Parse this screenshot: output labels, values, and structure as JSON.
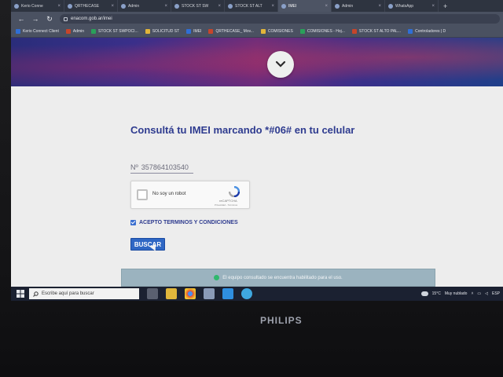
{
  "browser": {
    "tabs": [
      {
        "label": "Kerio Conne"
      },
      {
        "label": "QRTHECASE"
      },
      {
        "label": "Admin"
      },
      {
        "label": "STOCK ST SW"
      },
      {
        "label": "STOCK ST ALT"
      },
      {
        "label": "IMEI",
        "active": true
      },
      {
        "label": "Admin"
      },
      {
        "label": "WhatsApp"
      }
    ],
    "new_tab": "+",
    "url": "enacom.gob.ar/imei",
    "bookmarks": [
      {
        "label": "Kerio Connect Client"
      },
      {
        "label": "Admin"
      },
      {
        "label": "STOCK ST SWPOCI..."
      },
      {
        "label": "SOLICITUD ST"
      },
      {
        "label": "IMEI"
      },
      {
        "label": "QRTHECASE_ Mov..."
      },
      {
        "label": "COMISIONES"
      },
      {
        "label": "COMISIONES - Hoj..."
      },
      {
        "label": "STOCK ST ALTO PAL..."
      },
      {
        "label": "Controladores | D"
      }
    ]
  },
  "page": {
    "title": "Consultá tu IMEI marcando *#06# en tu celular",
    "imei_prefix": "Nº",
    "imei_value": "357864103540",
    "captcha": {
      "label": "No soy un robot",
      "brand": "reCAPTCHA",
      "terms": "Privacidad - Términos"
    },
    "terms_label": "ACEPTO TERMINOS Y CONDICIONES",
    "search_button": "BUSCAR",
    "result_message": "El equipo consultado se encuentra habilitado para el uso."
  },
  "taskbar": {
    "search_placeholder": "Escribe aquí para buscar",
    "temperature": "15°C",
    "weather": "Muy nublado",
    "language": "ESP"
  },
  "monitor": {
    "brand": "PHILIPS"
  }
}
